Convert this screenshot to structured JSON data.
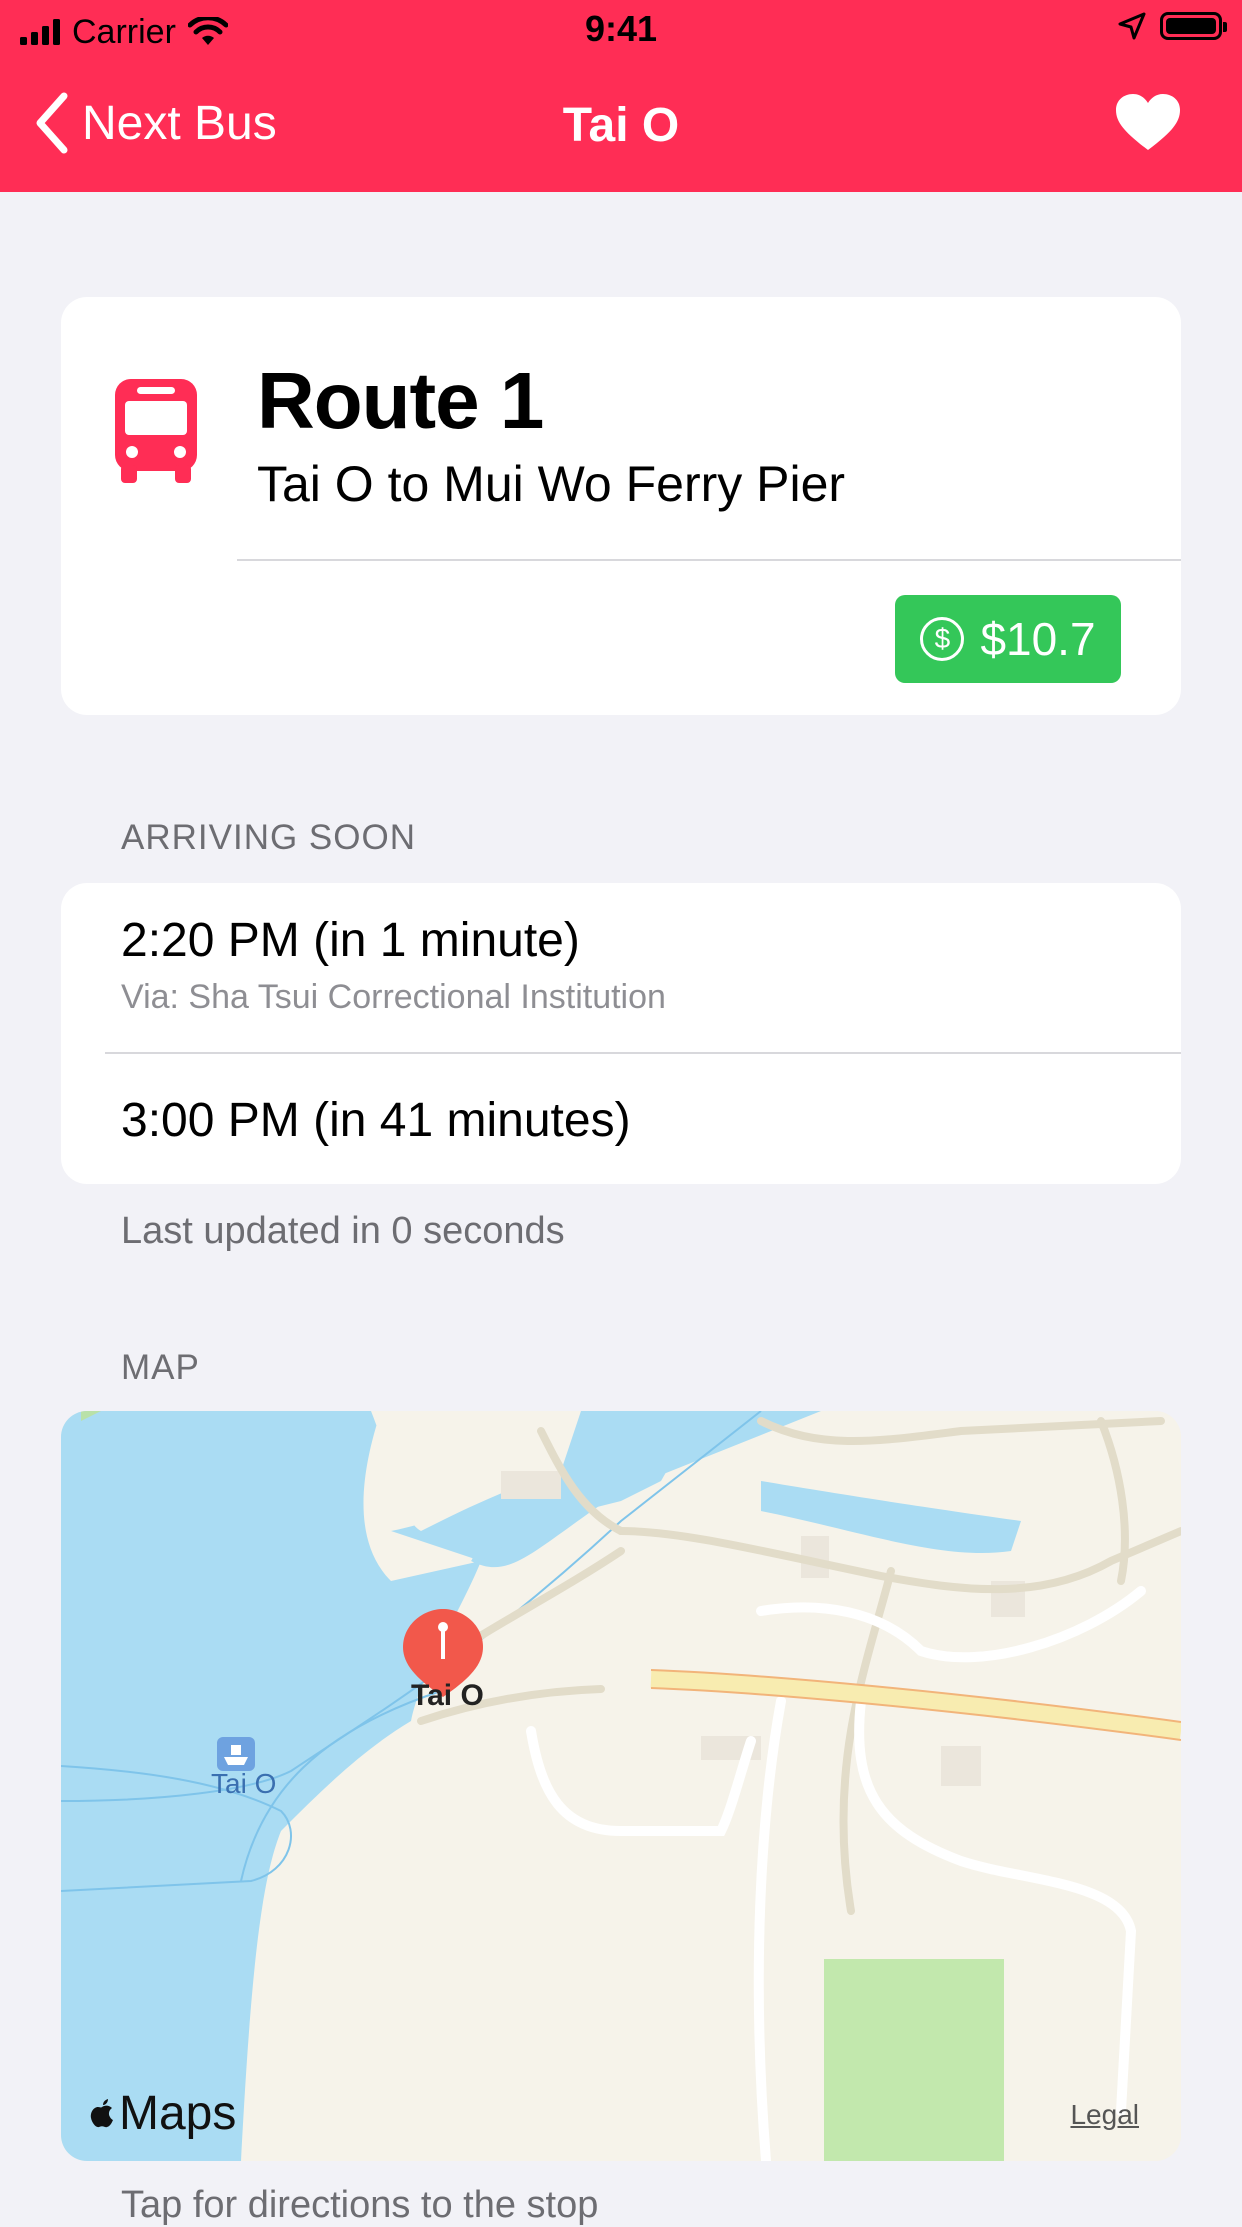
{
  "status_bar": {
    "carrier": "Carrier",
    "time": "9:41"
  },
  "nav": {
    "back_label": "Next Bus",
    "title": "Tai O",
    "favorite_icon": "heart-icon"
  },
  "route": {
    "title": "Route 1",
    "subtitle": "Tai O to Mui Wo Ferry Pier",
    "fare": "$10.7",
    "icon": "bus-icon",
    "accent": "#ff2d55",
    "fare_color": "#34c759"
  },
  "arrivals": {
    "section_label": "ARRIVING SOON",
    "items": [
      {
        "time": "2:20 PM (in 1 minute)",
        "via": "Via: Sha Tsui Correctional Institution"
      },
      {
        "time": "3:00 PM (in 41 minutes)"
      }
    ],
    "footer": "Last updated in 0 seconds"
  },
  "map": {
    "section_label": "MAP",
    "pin_label": "Tai O",
    "ferry_label": "Tai O",
    "brand": "Maps",
    "legal": "Legal",
    "footer": "Tap for directions to the stop"
  }
}
